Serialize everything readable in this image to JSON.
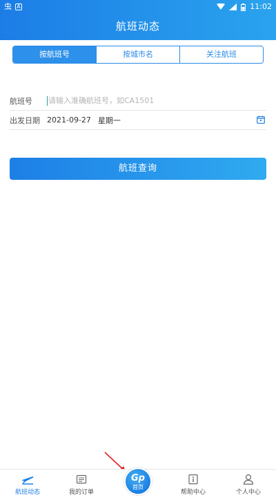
{
  "statusbar": {
    "time": "11:02",
    "left_icon_1": "虫",
    "left_icon_2": "A"
  },
  "header": {
    "title": "航班动态"
  },
  "tabs": [
    {
      "label": "按航班号",
      "active": true
    },
    {
      "label": "按城市名",
      "active": false
    },
    {
      "label": "关注航班",
      "active": false
    }
  ],
  "form": {
    "flight_no": {
      "label": "航班号",
      "placeholder": "请输入准确航班号，如CA1501",
      "value": ""
    },
    "departure_date": {
      "label": "出发日期",
      "date": "2021-09-27",
      "weekday": "星期一"
    }
  },
  "search_button": {
    "label": "航班查询"
  },
  "bottom_nav": {
    "items": [
      {
        "label": "航班动态",
        "icon": "airplane-icon",
        "active": true
      },
      {
        "label": "我的订单",
        "icon": "order-list-icon",
        "active": false
      },
      {
        "label": "帮助中心",
        "icon": "info-icon",
        "active": false
      },
      {
        "label": "个人中心",
        "icon": "person-icon",
        "active": false
      }
    ],
    "home": {
      "logo": "Gp",
      "label": "首页"
    }
  },
  "colors": {
    "brand_blue": "#1e7fe4",
    "accent_light": "#30aaf0",
    "arrow_red": "#e02020"
  }
}
